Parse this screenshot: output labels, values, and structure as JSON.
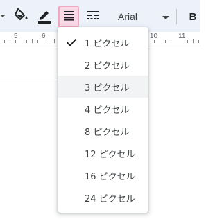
{
  "toolbar": {
    "font_name": "Arial",
    "bold_label": "B",
    "accent": "#f2a6c0"
  },
  "ruler": {
    "labels": [
      "5",
      "6",
      "10",
      "11"
    ]
  },
  "border_width_menu": {
    "selected": "1 ピクセル",
    "hovered": "3 ピクセル",
    "items": [
      {
        "label": "1 ピクセル"
      },
      {
        "label": "2 ピクセル"
      },
      {
        "label": "3 ピクセル"
      },
      {
        "label": "4 ピクセル"
      },
      {
        "label": "8 ピクセル"
      },
      {
        "label": "12 ピクセル"
      },
      {
        "label": "16 ピクセル"
      },
      {
        "label": "24 ピクセル"
      }
    ]
  }
}
